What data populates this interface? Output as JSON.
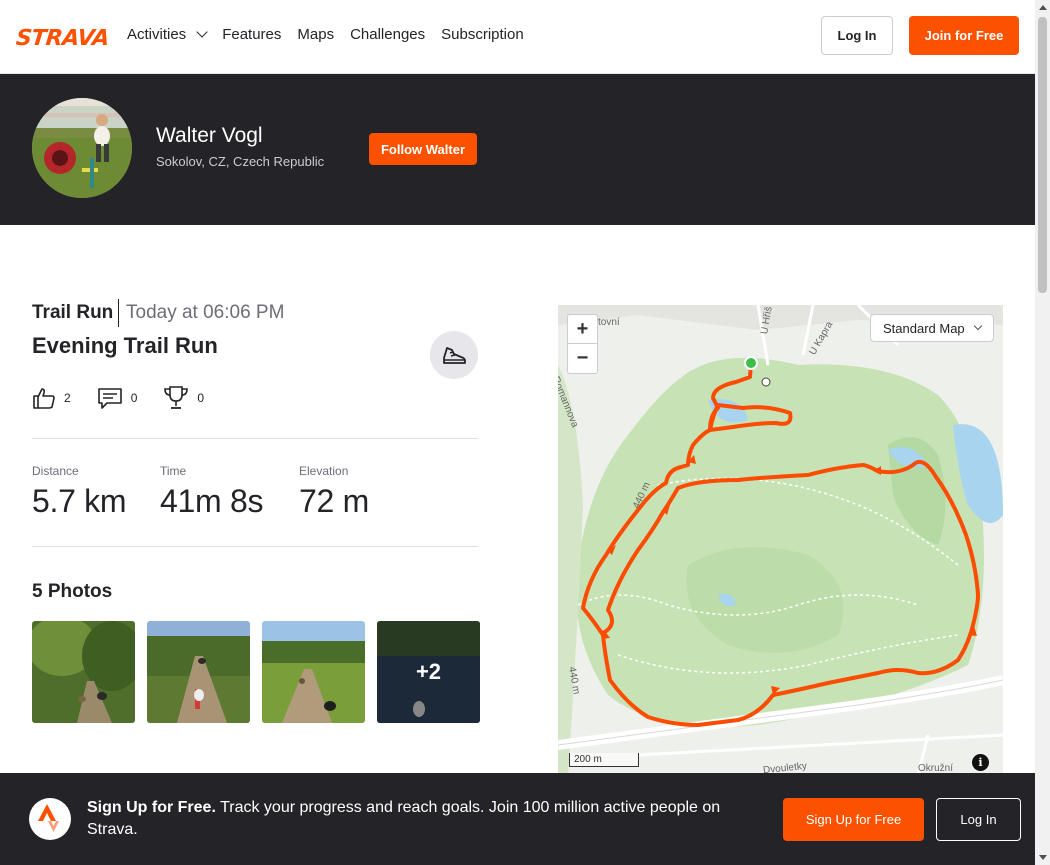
{
  "nav": {
    "logo": "STRAVA",
    "links": [
      "Activities",
      "Features",
      "Maps",
      "Challenges",
      "Subscription"
    ],
    "login_label": "Log In",
    "join_label": "Join for Free"
  },
  "athlete": {
    "name": "Walter Vogl",
    "location": "Sokolov, CZ, Czech Republic",
    "follow_label": "Follow Walter"
  },
  "activity": {
    "type": "Trail Run",
    "time": "Today at 06:06 PM",
    "title": "Evening Trail Run",
    "kudos": "2",
    "comments": "0",
    "achievements": "0",
    "stats": [
      {
        "label": "Distance",
        "value": "5.7 km"
      },
      {
        "label": "Time",
        "value": "41m 8s"
      },
      {
        "label": "Elevation",
        "value": "72 m"
      }
    ],
    "photos_title": "5 Photos",
    "photos_more": "+2"
  },
  "map": {
    "zoom_in": "+",
    "zoom_out": "−",
    "style_label": "Standard Map",
    "scale_label": "200 m",
    "info": "i",
    "street_labels": [
      "tovní",
      "U Hřiš",
      "U Kapra",
      "Romannova",
      "440 m",
      "440 m",
      "Okružní",
      "Dvouletky",
      "440 m"
    ],
    "route_color": "#fc4c02"
  },
  "banner": {
    "headline": "Sign Up for Free.",
    "text": "Track your progress and reach goals. Join 100 million active people on Strava.",
    "signup_label": "Sign Up for Free",
    "login_label": "Log In"
  },
  "colors": {
    "brand": "#fc5200",
    "dark": "#242428"
  }
}
